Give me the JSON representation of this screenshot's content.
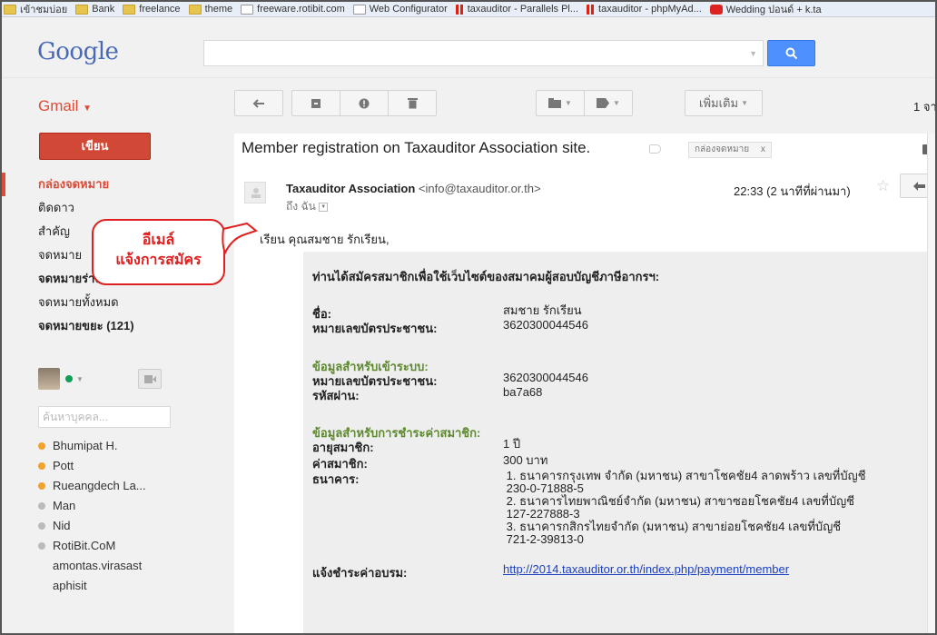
{
  "bookmarks": [
    {
      "label": "เข้าชมบ่อย",
      "icon": "folder-icon"
    },
    {
      "label": "Bank",
      "icon": "folder-icon"
    },
    {
      "label": "freelance",
      "icon": "folder-icon"
    },
    {
      "label": "theme",
      "icon": "folder-icon"
    },
    {
      "label": "freeware.rotibit.com",
      "icon": "page-icon"
    },
    {
      "label": "Web Configurator",
      "icon": "page-icon"
    },
    {
      "label": "taxauditor - Parallels Pl...",
      "icon": "parallels-icon"
    },
    {
      "label": "taxauditor - phpMyAd...",
      "icon": "parallels-icon"
    },
    {
      "label": "Wedding ปอนด์ + k.ta",
      "icon": "video-icon"
    }
  ],
  "google": {
    "logo": "Google"
  },
  "toolbar": {
    "gmail_label": "Gmail",
    "more_label": "เพิ่มเติม",
    "pager": "1 จา"
  },
  "sidebar": {
    "compose": "เขียน",
    "items": [
      {
        "label": "กล่องจดหมาย"
      },
      {
        "label": "ติดดาว"
      },
      {
        "label": "สำคัญ"
      },
      {
        "label": "จดหมาย"
      },
      {
        "label": "จดหมายร่าง (6)"
      },
      {
        "label": "จดหมายทั้งหมด"
      },
      {
        "label": "จดหมายขยะ (121)"
      }
    ],
    "people_placeholder": "ค้นหาบุคคล...",
    "contacts": [
      {
        "name": "Bhumipat H.",
        "status": "away"
      },
      {
        "name": "Pott",
        "status": "away"
      },
      {
        "name": "Rueangdech La...",
        "status": "away"
      },
      {
        "name": "Man",
        "status": "offline"
      },
      {
        "name": "Nid",
        "status": "offline"
      },
      {
        "name": "RotiBit.CoM",
        "status": "offline"
      },
      {
        "name": "amontas.virasast",
        "status": "none"
      },
      {
        "name": "aphisit",
        "status": "none"
      }
    ]
  },
  "colors": {
    "accent": "#dd4b39",
    "search_blue": "#4d90fe",
    "section_green": "#5e8a2e",
    "link_blue": "#1a3fc0",
    "status_away": "#f1a32e",
    "status_online": "#0f9d58",
    "status_offline": "#bbbbbb"
  },
  "email": {
    "subject": "Member registration on Taxauditor Association site.",
    "label": "กล่องจดหมาย",
    "label_close": "x",
    "sender_name": "Taxauditor Association",
    "sender_email": "<info@taxauditor.or.th>",
    "to": "ถึง ฉัน",
    "time": "22:33 (2 นาทีที่ผ่านมา)",
    "greeting": "เรียน คุณสมชาย รักเรียน,",
    "intro": "ท่านได้สมัครสมาชิกเพื่อใช้เว็บไซต์ของสมาคมผู้สอบบัญชีภาษีอากรฯ:",
    "rows1": [
      {
        "k": "ชื่อ:",
        "v": "สมชาย รักเรียน"
      },
      {
        "k": "หมายเลขบัตรประชาชน:",
        "v": "3620300044546"
      }
    ],
    "section_login": "ข้อมูลสำหรับเข้าระบบ:",
    "rows2": [
      {
        "k": "หมายเลขบัตรประชาชน:",
        "v": "3620300044546"
      },
      {
        "k": "รหัสผ่าน:",
        "v": "ba7a68"
      }
    ],
    "section_pay": "ข้อมูลสำหรับการชำระค่าสมาชิก:",
    "rows3": [
      {
        "k": "อายุสมาชิก:",
        "v": "1 ปี"
      },
      {
        "k": "ค่าสมาชิก:",
        "v": "300 บาท"
      }
    ],
    "bank_key": "ธนาคาร:",
    "banks": [
      "1. ธนาคารกรุงเทพ จำกัด (มหาชน) สาขาโชคชัย4 ลาดพร้าว เลขที่บัญชี",
      "230-0-71888-5",
      "2. ธนาคารไทยพาณิชย์จำกัด (มหาชน) สาขาซอยโชคชัย4 เลขที่บัญชี",
      "127-227888-3",
      "3. ธนาคารกสิกรไทยจำกัด (มหาชน) สาขาย่อยโชคชัย4 เลขที่บัญชี",
      "721-2-39813-0"
    ],
    "payment_key": "แจ้งชำระค่าอบรม:",
    "payment_link": "http://2014.taxauditor.or.th/index.php/payment/member"
  },
  "callout": {
    "line1": "อีเมล์",
    "line2": "แจ้งการสมัคร"
  }
}
